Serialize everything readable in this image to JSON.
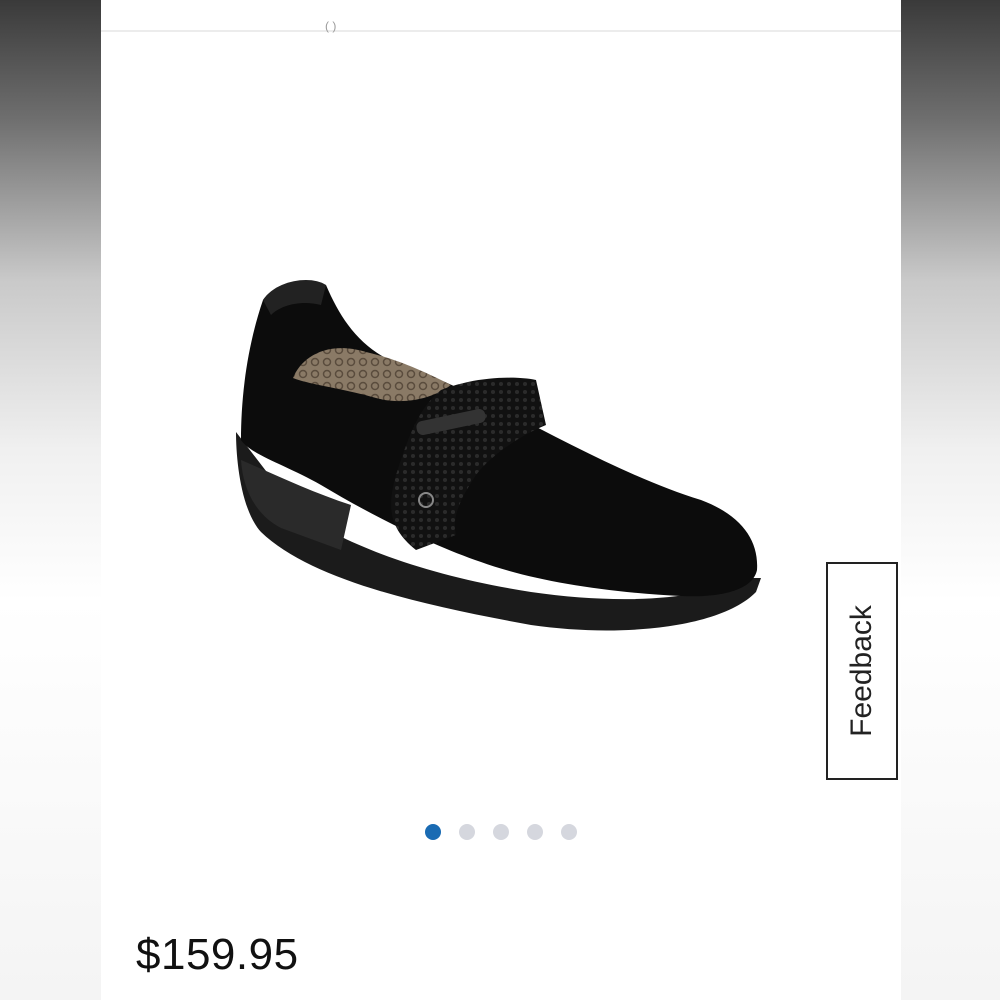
{
  "top_glyph": "( )",
  "product": {
    "image_icon": "black-slip-on-wedge-shoe",
    "price": "$159.95"
  },
  "carousel": {
    "active_index": 0,
    "count": 5,
    "colors": {
      "active": "#1a6bb3",
      "inactive": "#d5d7de"
    }
  },
  "feedback": {
    "label": "Feedback"
  }
}
